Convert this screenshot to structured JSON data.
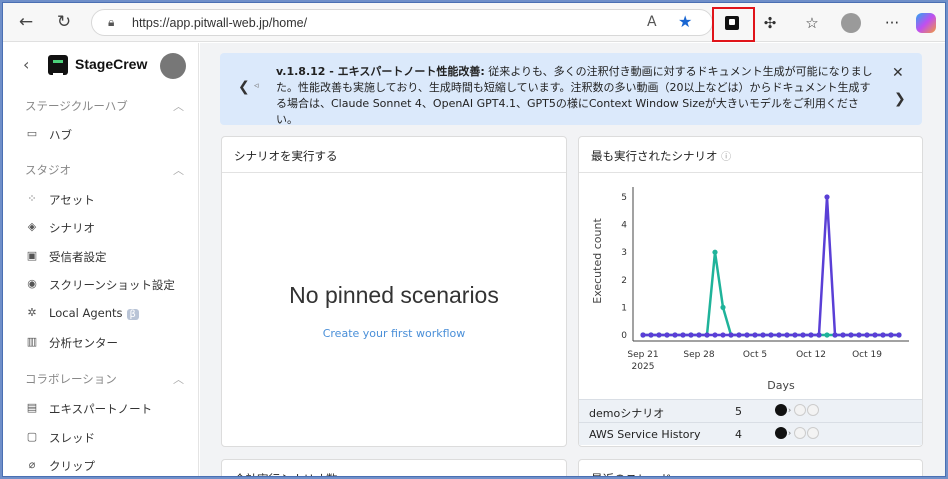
{
  "browser": {
    "url": "https://app.pitwall-web.jp/home/",
    "reader_icon": "A",
    "more_label": "···"
  },
  "sidebar": {
    "brand": "StageCrew",
    "sections": [
      {
        "title": "ステージクルーハブ",
        "items": [
          {
            "label": "ハブ",
            "icon": "folder-icon"
          }
        ]
      },
      {
        "title": "スタジオ",
        "items": [
          {
            "label": "アセット",
            "icon": "grid-icon"
          },
          {
            "label": "シナリオ",
            "icon": "layers-icon"
          },
          {
            "label": "受信者設定",
            "icon": "inbox-icon"
          },
          {
            "label": "スクリーンショット設定",
            "icon": "camera-icon"
          },
          {
            "label": "Local Agents",
            "icon": "chip-icon",
            "badge": "β"
          },
          {
            "label": "分析センター",
            "icon": "bar-chart-icon"
          }
        ]
      },
      {
        "title": "コラボレーション",
        "items": [
          {
            "label": "エキスパートノート",
            "icon": "note-icon"
          },
          {
            "label": "スレッド",
            "icon": "thread-icon"
          },
          {
            "label": "クリップ",
            "icon": "clip-icon"
          }
        ]
      }
    ]
  },
  "notice": {
    "title": "v.1.8.12 - エキスパートノート性能改善:",
    "body": "従来よりも、多くの注釈付き動画に対するドキュメント生成が可能になりました。性能改善も実施しており、生成時間も短縮しています。注釈数の多い動画（20以上などは）からドキュメント生成する場合は、Claude Sonnet 4、OpenAI GPT4.1、GPT5の様にContext Window Sizeが大きいモデルをご利用ください。"
  },
  "pinned": {
    "title": "シナリオを実行する",
    "empty_title": "No pinned scenarios",
    "empty_link": "Create your first workflow"
  },
  "most_run": {
    "title": "最も実行されたシナリオ",
    "rows": [
      {
        "name": "demoシナリオ",
        "count": "5",
        "services": "aws google"
      },
      {
        "name": "AWS Service History",
        "count": "4",
        "services": "aws aws"
      }
    ]
  },
  "bottom_cards": {
    "left_title": "合計実行シナリオ数",
    "right_title": "最近のスレッド"
  },
  "colors": {
    "teal": "#1fb39a",
    "purple": "#5a3fd6",
    "accent": "#4a8fd8",
    "highlight": "#e0141a"
  },
  "chart_data": {
    "type": "line",
    "xlabel": "Days",
    "ylabel": "Executed count",
    "ylim": [
      0,
      5
    ],
    "yticks": [
      "0",
      "1",
      "2",
      "3",
      "4",
      "5"
    ],
    "xticks": [
      "Sep 21\n2025",
      "Sep 28",
      "Oct 5",
      "Oct 12",
      "Oct 19"
    ],
    "x": [
      "Sep 21",
      "Sep 22",
      "Sep 23",
      "Sep 24",
      "Sep 25",
      "Sep 26",
      "Sep 27",
      "Sep 28",
      "Sep 29",
      "Sep 30",
      "Oct 1",
      "Oct 2",
      "Oct 3",
      "Oct 4",
      "Oct 5",
      "Oct 6",
      "Oct 7",
      "Oct 8",
      "Oct 9",
      "Oct 10",
      "Oct 11",
      "Oct 12",
      "Oct 13",
      "Oct 14",
      "Oct 15",
      "Oct 16",
      "Oct 17",
      "Oct 18",
      "Oct 19",
      "Oct 20",
      "Oct 21",
      "Oct 22",
      "Oct 23"
    ],
    "series": [
      {
        "name": "demoシナリオ",
        "color": "#1fb39a",
        "values": [
          0,
          0,
          0,
          0,
          0,
          0,
          0,
          0,
          0,
          3,
          1,
          0,
          0,
          0,
          0,
          0,
          0,
          0,
          0,
          0,
          0,
          0,
          0,
          0,
          0,
          0,
          0,
          0,
          0,
          0,
          0,
          0,
          0
        ]
      },
      {
        "name": "AWS Service History",
        "color": "#5a3fd6",
        "values": [
          0,
          0,
          0,
          0,
          0,
          0,
          0,
          0,
          0,
          0,
          0,
          0,
          0,
          0,
          0,
          0,
          0,
          0,
          0,
          0,
          0,
          0,
          0,
          5,
          0,
          0,
          0,
          0,
          0,
          0,
          0,
          0,
          0
        ]
      }
    ]
  }
}
